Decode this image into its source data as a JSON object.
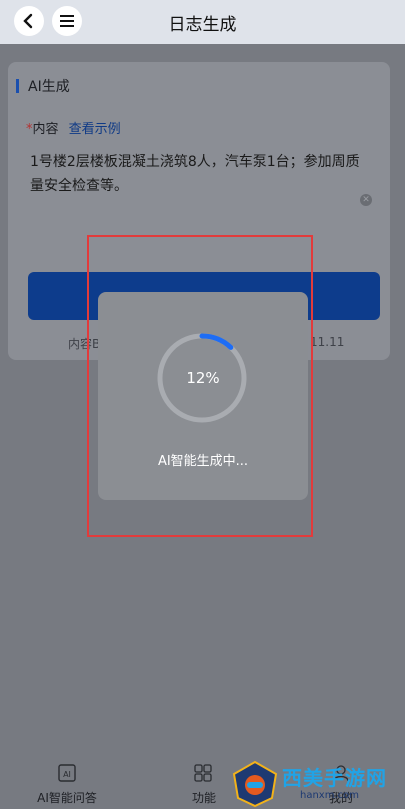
{
  "header": {
    "title": "日志生成",
    "back_icon": "chevron-left-icon",
    "menu_icon": "menu-icon"
  },
  "form": {
    "section_title": "AI生成",
    "content_label": "内容",
    "required_mark": "*",
    "example_link": "查看示例",
    "content_value": "1号楼2层楼板混凝土浇筑8人，汽车泵1台；参加周质量安全检查等。",
    "footer_left": "内容B",
    "footer_right": "11.11"
  },
  "loading": {
    "progress_percent": 12,
    "progress_label": "12%",
    "message": "AI智能生成中..."
  },
  "tabs": [
    {
      "label": "AI智能问答",
      "icon": "ai-chat-icon"
    },
    {
      "label": "功能",
      "icon": "grid-icon"
    },
    {
      "label": "我的",
      "icon": "user-icon"
    }
  ],
  "watermark": {
    "name": "西美手游网",
    "url": "hanxm.com"
  },
  "colors": {
    "accent": "#0d3c8c",
    "progress": "#1e6df5",
    "highlight": "#e23b3b"
  }
}
